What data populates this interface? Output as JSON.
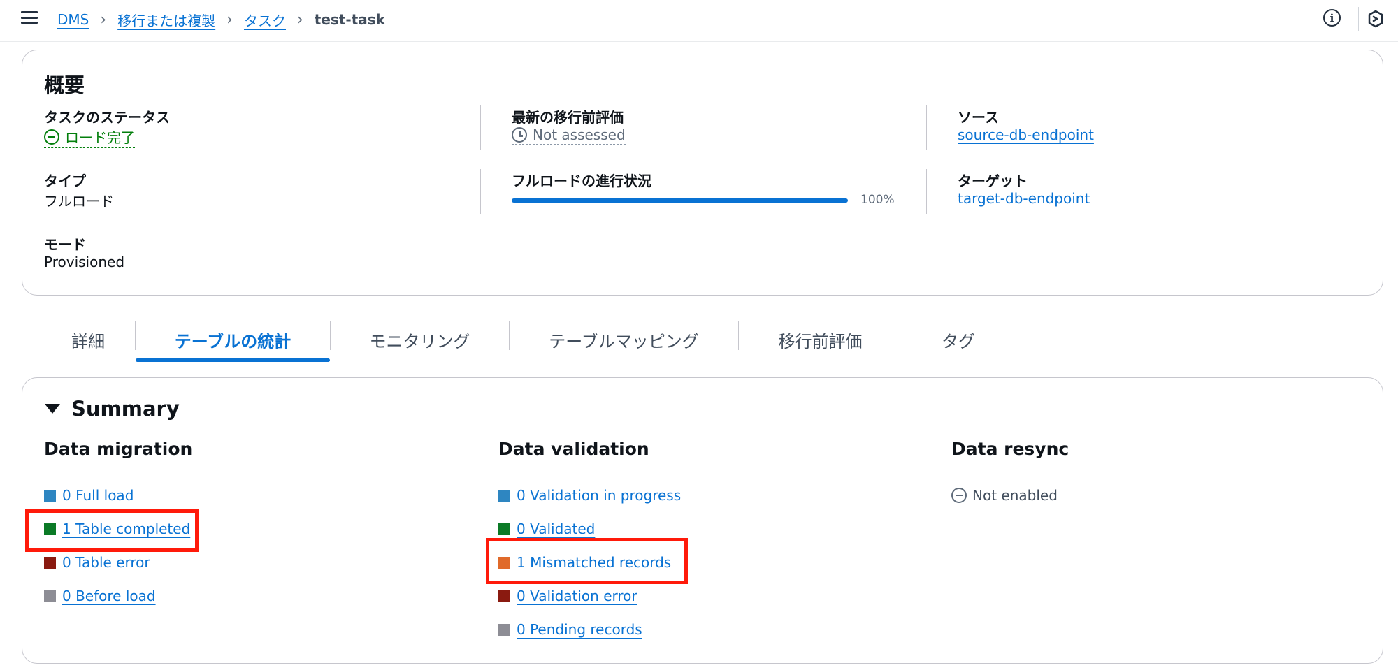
{
  "breadcrumbs": {
    "items": [
      "DMS",
      "移行または複製",
      "タスク"
    ],
    "current": "test-task"
  },
  "overview": {
    "title": "概要",
    "task_status": {
      "label": "タスクのステータス",
      "value": "ロード完了"
    },
    "type": {
      "label": "タイプ",
      "value": "フルロード"
    },
    "mode": {
      "label": "モード",
      "value": "Provisioned"
    },
    "assessment": {
      "label": "最新の移行前評価",
      "value": "Not assessed"
    },
    "full_load_progress": {
      "label": "フルロードの進行状況",
      "percent_text": "100%",
      "percent": 100
    },
    "source": {
      "label": "ソース",
      "value": "source-db-endpoint"
    },
    "target": {
      "label": "ターゲット",
      "value": "target-db-endpoint"
    }
  },
  "tabs": [
    {
      "label": "詳細",
      "active": false
    },
    {
      "label": "テーブルの統計",
      "active": true
    },
    {
      "label": "モニタリング",
      "active": false
    },
    {
      "label": "テーブルマッピング",
      "active": false
    },
    {
      "label": "移行前評価",
      "active": false
    },
    {
      "label": "タグ",
      "active": false
    }
  ],
  "summary": {
    "title": "Summary",
    "data_migration": {
      "title": "Data migration",
      "items": [
        {
          "label": "0 Full load",
          "color": "#2e86c1"
        },
        {
          "label": "1 Table completed",
          "color": "#0b7a26"
        },
        {
          "label": "0 Table error",
          "color": "#8a1a10"
        },
        {
          "label": "0 Before load",
          "color": "#8d8d95"
        }
      ]
    },
    "data_validation": {
      "title": "Data validation",
      "items": [
        {
          "label": "0 Validation in progress",
          "color": "#2e86c1"
        },
        {
          "label": "0 Validated",
          "color": "#0b7a26"
        },
        {
          "label": "1 Mismatched records",
          "color": "#e06a2a"
        },
        {
          "label": "0 Validation error",
          "color": "#8a1a10"
        },
        {
          "label": "0 Pending records",
          "color": "#8d8d95"
        }
      ]
    },
    "data_resync": {
      "title": "Data resync",
      "status": "Not enabled"
    }
  },
  "colors": {
    "link": "#0972d3",
    "success": "#037f0c",
    "highlight": "#ff1a0a"
  },
  "icons": [
    "menu-icon",
    "chevron-right-icon",
    "info-icon",
    "hexagon-icon",
    "status-ok-icon",
    "clock-icon",
    "caret-down-icon",
    "not-enabled-icon"
  ]
}
